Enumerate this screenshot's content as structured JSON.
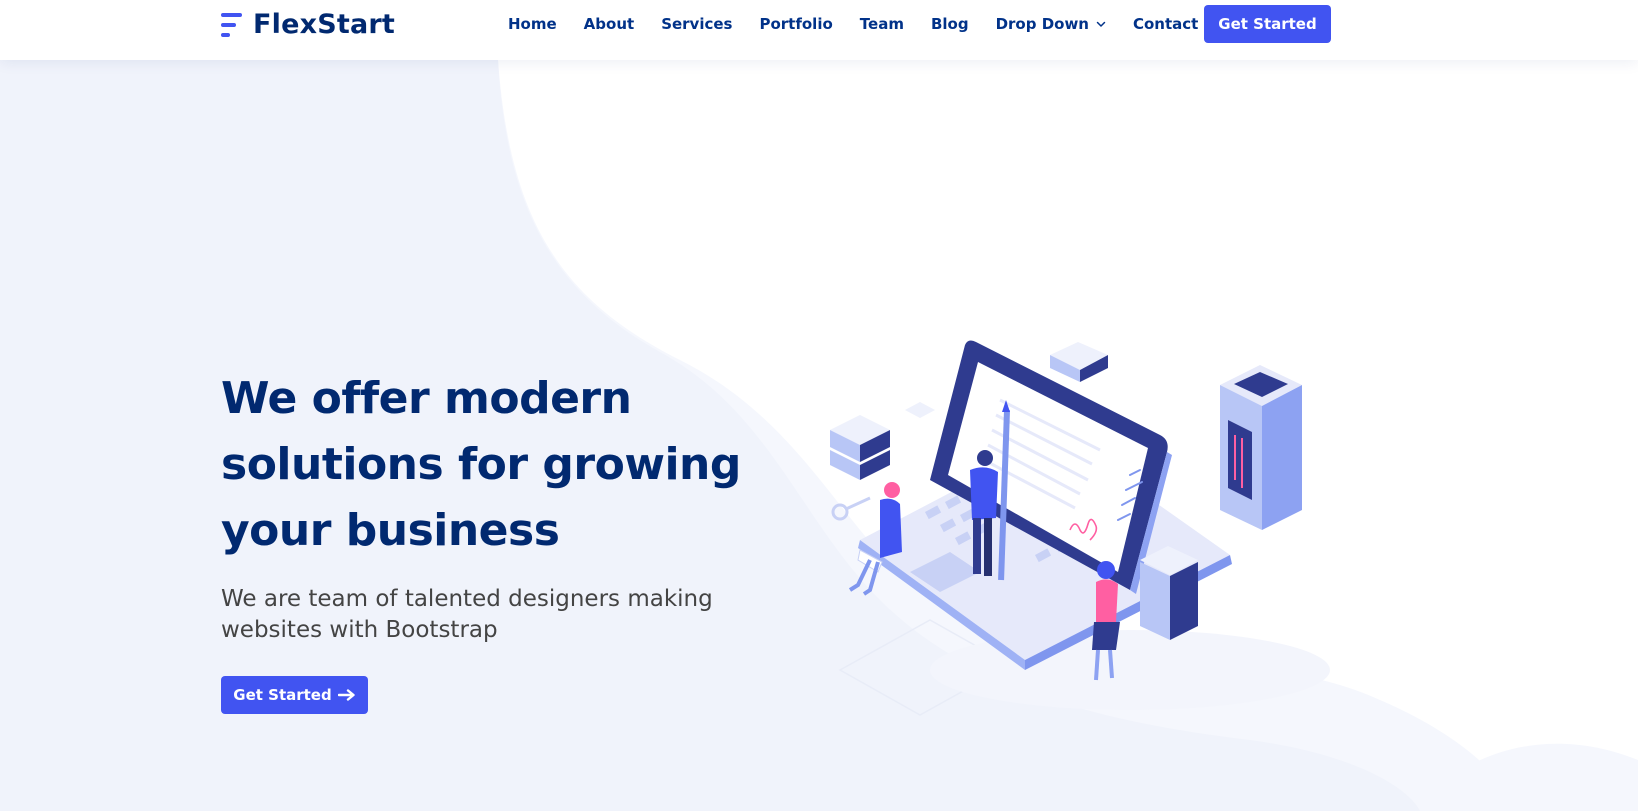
{
  "brand": {
    "name": "FlexStart"
  },
  "nav": {
    "items": [
      "Home",
      "About",
      "Services",
      "Portfolio",
      "Team",
      "Blog",
      "Drop Down",
      "Contact"
    ],
    "cta_label": "Get Started"
  },
  "hero": {
    "title": "We offer modern solutions for growing your business",
    "subtitle": "We are team of talented designers making websites with Bootstrap",
    "cta_label": "Get Started"
  },
  "colors": {
    "primary": "#4154f1",
    "heading": "#012970",
    "nav_text": "#013289",
    "body_text": "#444444",
    "hero_tint": "#f0f3fb"
  },
  "icons": {
    "logo": "flexstart-logo-icon",
    "dropdown": "chevron-down-icon",
    "cta_arrow": "arrow-right-icon"
  }
}
